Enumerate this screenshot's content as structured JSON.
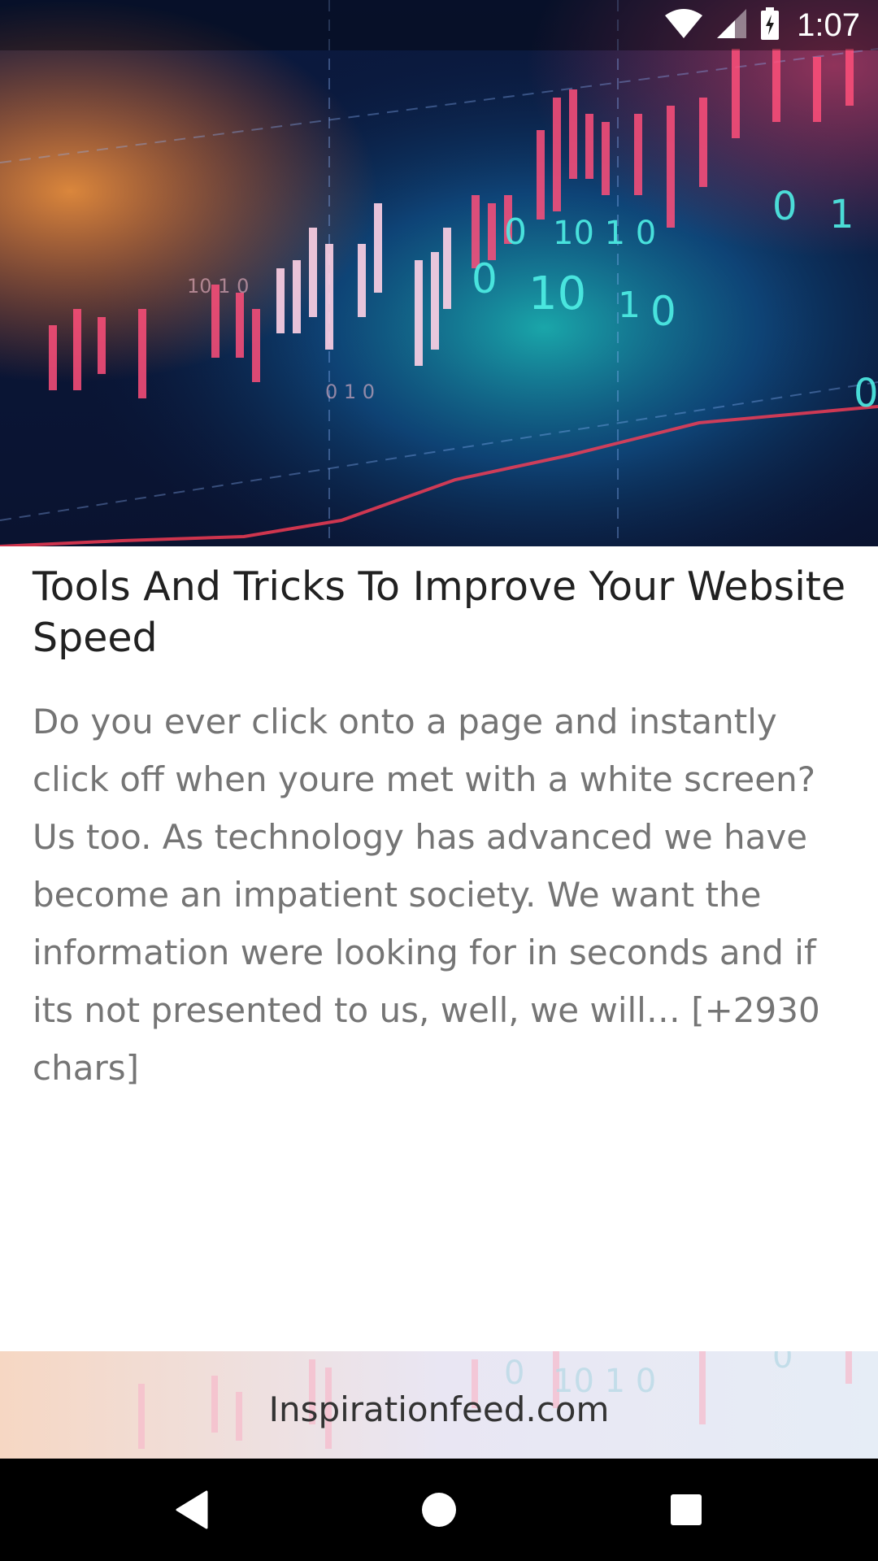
{
  "status_bar": {
    "time": "1:07",
    "icons": [
      "wifi-icon",
      "cell-signal-icon",
      "battery-charging-icon"
    ]
  },
  "hero_image": {
    "description_icon": "stock-chart-image"
  },
  "article": {
    "title": "Tools And Tricks To Improve Your Website Speed",
    "description": "Do you ever click onto a page and instantly click off when youre met with a white screen? Us too. As technology has advanced we have become an impatient society. We want the information were looking for in seconds and if its not presented to us, well, we will… [+2930 chars]"
  },
  "source": {
    "label": "Inspirationfeed.com"
  },
  "nav_bar": {
    "buttons": [
      "back-icon",
      "home-icon",
      "recents-icon"
    ]
  },
  "colors": {
    "title": "#212121",
    "description": "#757575",
    "nav_background": "#000000"
  }
}
